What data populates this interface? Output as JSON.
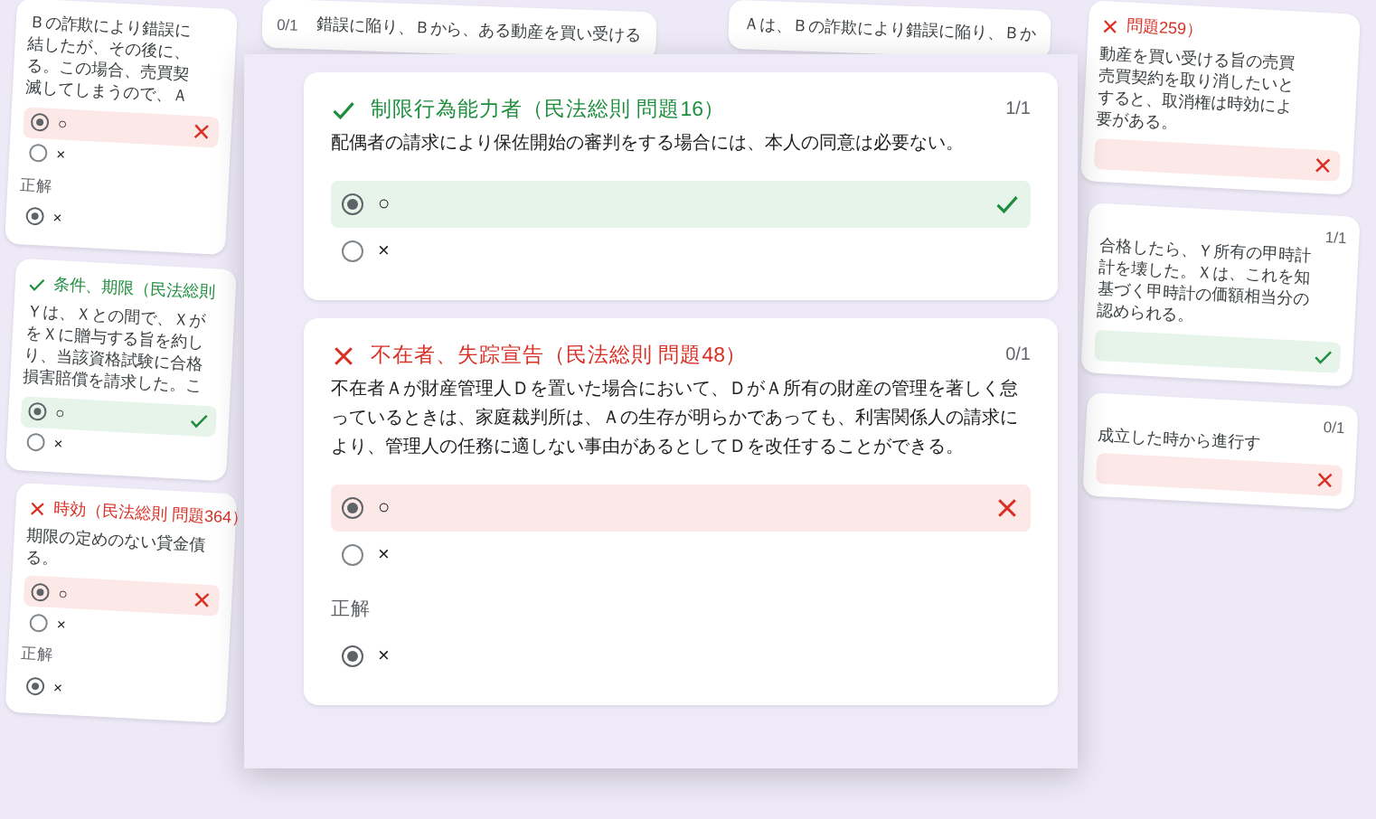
{
  "background_cards": {
    "top": [
      {
        "lines": [
          "錯誤に陥り、Ｂから、ある動産を買い受ける"
        ],
        "score": "0/1"
      },
      {
        "lines": [
          "Ａは、Ｂの詐欺により錯誤に陥り、Ｂか"
        ]
      }
    ],
    "left": [
      {
        "correct": false,
        "lines": [
          "Ｂの詐欺により錯誤に",
          "結したが、その後に、",
          "る。この場合、売買契",
          "滅してしまうので、Ａ"
        ],
        "options": [
          {
            "label": "○",
            "selected": true
          },
          {
            "label": "×",
            "selected": false
          }
        ],
        "correct_answer": {
          "heading": "正解",
          "label": "×",
          "selected": true
        }
      },
      {
        "correct": true,
        "title": "条件、期限（民法総則",
        "lines": [
          "Ｙは、Ｘとの間で、Ｘが",
          "をＸに贈与する旨を約し",
          "り、当該資格試験に合格",
          "損害賠償を請求した。こ"
        ],
        "options": [
          {
            "label": "○",
            "selected": true
          },
          {
            "label": "×",
            "selected": false
          }
        ]
      },
      {
        "correct": false,
        "title": "時効（民法総則 問題364）",
        "lines": [
          "期限の定めのない貸金債",
          "る。"
        ],
        "options": [
          {
            "label": "○",
            "selected": true
          },
          {
            "label": "×",
            "selected": false
          }
        ],
        "correct_answer": {
          "heading": "正解",
          "label": "×",
          "selected": true
        }
      }
    ],
    "right": [
      {
        "correct": false,
        "title": "問題259）",
        "lines": [
          "動産を買い受ける旨の売買",
          "売買契約を取り消したいと",
          "すると、取消権は時効によ",
          "要がある。"
        ],
        "options": [
          {
            "selected": true
          }
        ]
      },
      {
        "correct": true,
        "score": "1/1",
        "lines": [
          "合格したら、Ｙ所有の甲時計",
          "計を壊した。Ｘは、これを知",
          "基づく甲時計の価額相当分の",
          "認められる。"
        ],
        "options": [
          {
            "selected": true
          }
        ]
      },
      {
        "correct": false,
        "score": "0/1",
        "lines": [
          "成立した時から進行す"
        ],
        "options": [
          {
            "selected": true
          }
        ]
      }
    ]
  },
  "main_panel": {
    "questions": [
      {
        "correct": true,
        "title": "制限行為能力者（民法総則 問題16）",
        "score": "1/1",
        "text": "配偶者の請求により保佐開始の審判をする場合には、本人の同意は必要ない。",
        "options": [
          {
            "label": "○",
            "selected": true
          },
          {
            "label": "×",
            "selected": false
          }
        ]
      },
      {
        "correct": false,
        "title": "不在者、失踪宣告（民法総則 問題48）",
        "score": "0/1",
        "text": "不在者Ａが財産管理人Ｄを置いた場合において、ＤがＡ所有の財産の管理を著しく怠っているときは、家庭裁判所は、Ａの生存が明らかであっても、利害関係人の請求により、管理人の任務に適しない事由があるとしてＤを改任することができる。",
        "options": [
          {
            "label": "○",
            "selected": true
          },
          {
            "label": "×",
            "selected": false
          }
        ],
        "correct_answer": {
          "heading": "正解",
          "label": "×",
          "selected": true
        }
      }
    ]
  }
}
